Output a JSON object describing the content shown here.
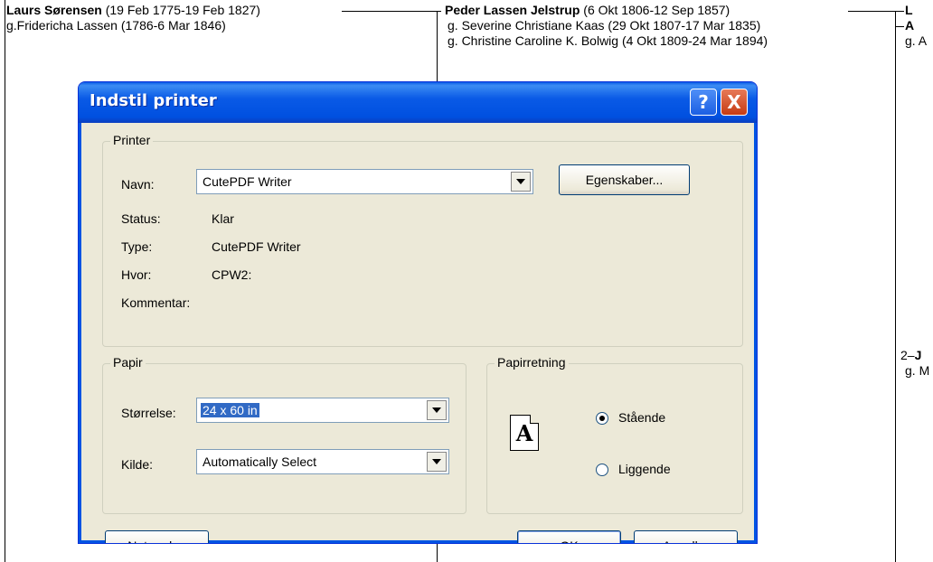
{
  "background": {
    "person1": {
      "name": "Laurs Sørensen",
      "dates": "(19 Feb 1775-19 Feb 1827)"
    },
    "person1_spouse": "g.Fridericha Lassen (1786-6 Mar 1846)",
    "person2": {
      "name": "Peder Lassen Jelstrup",
      "dates": "(6 Okt 1806-12 Sep 1857)"
    },
    "person2_spouse1": "g. Severine Christiane Kaas (29 Okt 1807-17 Mar 1835)",
    "person2_spouse2": "g. Christine Caroline K. Bolwig (4 Okt 1809-24 Mar 1894)",
    "right_col": {
      "top": "L",
      "bold": "A",
      "spouse": "g. A",
      "mid_prefix": "2–",
      "mid_bold": "J",
      "mid_spouse": "g. M"
    }
  },
  "dialog": {
    "title": "Indstil printer",
    "help_glyph": "?",
    "close_glyph": "X",
    "printer": {
      "group_label": "Printer",
      "name_label": "Navn:",
      "name_value": "CutePDF Writer",
      "properties_button": "Egenskaber...",
      "status_label": "Status:",
      "status_value": "Klar",
      "type_label": "Type:",
      "type_value": "CutePDF Writer",
      "where_label": "Hvor:",
      "where_value": "CPW2:",
      "comment_label": "Kommentar:"
    },
    "paper": {
      "group_label": "Papir",
      "size_label": "Størrelse:",
      "size_value": "24 x 60 in",
      "source_label": "Kilde:",
      "source_value": "Automatically Select"
    },
    "orientation": {
      "group_label": "Papirretning",
      "icon_letter": "A",
      "portrait_label": "Stående",
      "landscape_label": "Liggende",
      "selected": "portrait"
    },
    "buttons": {
      "network": "Netværk...",
      "ok": "OK",
      "cancel": "Annuller"
    }
  }
}
